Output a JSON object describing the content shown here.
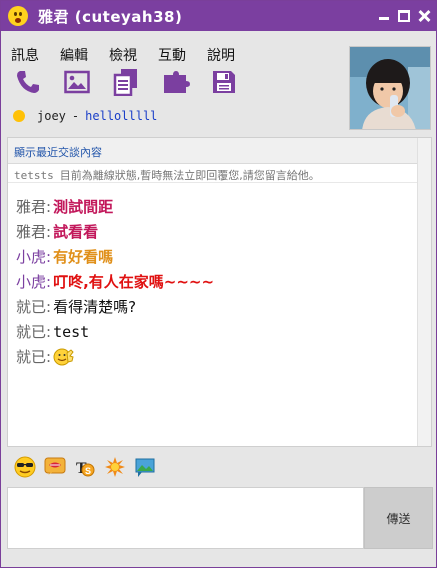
{
  "window": {
    "title": "雅君 (cuteyah38)",
    "accent": "#7b3fa0"
  },
  "menu": [
    "訊息",
    "編輯",
    "檢視",
    "互動",
    "說明"
  ],
  "toolbar": [
    "phone-icon",
    "photo-icon",
    "documents-icon",
    "plugin-icon",
    "save-icon"
  ],
  "status": {
    "name": "joey",
    "separator": "-",
    "message": "hellolllll"
  },
  "chat": {
    "show_recent": "顯示最近交談內容",
    "offline_user": "tetsts",
    "offline_text": "目前為離線狀態,暫時無法立即回覆您,請您留言給他。",
    "messages": [
      {
        "sender": "雅君",
        "text": "測試間距",
        "color": "#c2185b"
      },
      {
        "sender": "雅君",
        "text": "試看看",
        "color": "#c2185b"
      },
      {
        "sender": "小虎",
        "text": "有好看嗎",
        "color": "#e0901a"
      },
      {
        "sender": "小虎",
        "text": "叮咚,有人在家嗎~~~~",
        "color": "#e01010"
      },
      {
        "sender": "就已",
        "text": "看得清楚嗎?",
        "color": "#111111"
      },
      {
        "sender": "就已",
        "text": "test",
        "color": "#111111"
      },
      {
        "sender": "就已",
        "text": "",
        "color": "#111111",
        "emoticon": "waving-smiley-icon"
      }
    ]
  },
  "emoticons": [
    "sunglasses-icon",
    "lips-icon",
    "text-style-icon",
    "nudge-icon",
    "image-share-icon"
  ],
  "send_label": "傳送"
}
